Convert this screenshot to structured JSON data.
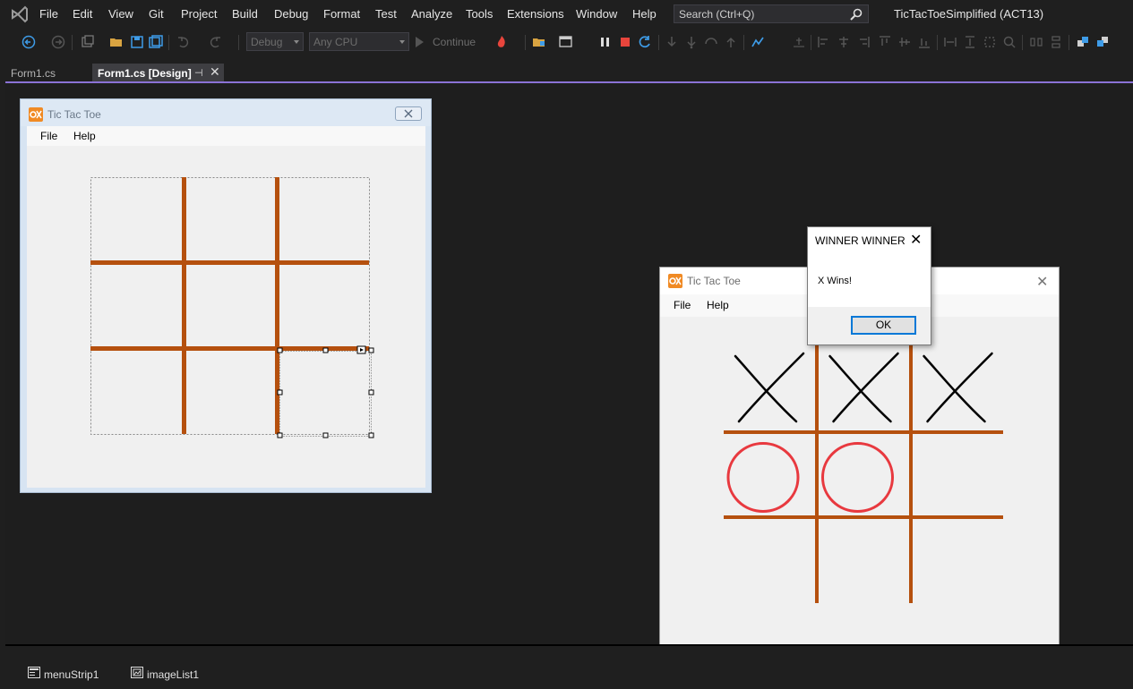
{
  "menubar": {
    "items": [
      "File",
      "Edit",
      "View",
      "Git",
      "Project",
      "Build",
      "Debug",
      "Format",
      "Test",
      "Analyze",
      "Tools",
      "Extensions",
      "Window",
      "Help"
    ],
    "search_placeholder": "Search (Ctrl+Q)",
    "solution_title": "TicTacToeSimplified (ACT13)"
  },
  "toolbar": {
    "config_value": "Debug",
    "platform_value": "Any CPU",
    "continue_label": "Continue"
  },
  "tabs": {
    "inactive_label": "Form1.cs",
    "active_label": "Form1.cs [Design]"
  },
  "designer_form": {
    "title": "Tic Tac Toe",
    "menu": [
      "File",
      "Help"
    ]
  },
  "game_form": {
    "title": "Tic Tac Toe",
    "menu": [
      "File",
      "Help"
    ],
    "board": [
      "X",
      "X",
      "X",
      "O",
      "O",
      "",
      "",
      "",
      ""
    ]
  },
  "message_box": {
    "title": "WINNER WINNER",
    "text": "X Wins!",
    "ok_label": "OK"
  },
  "tray": {
    "items": [
      "menuStrip1",
      "imageList1"
    ]
  },
  "colors": {
    "grid_brown": "#b5500e",
    "x_mark": "#000000",
    "o_mark": "#e8393f",
    "accent_purple": "#8b72d6",
    "ide_background": "#1f1f1f"
  }
}
